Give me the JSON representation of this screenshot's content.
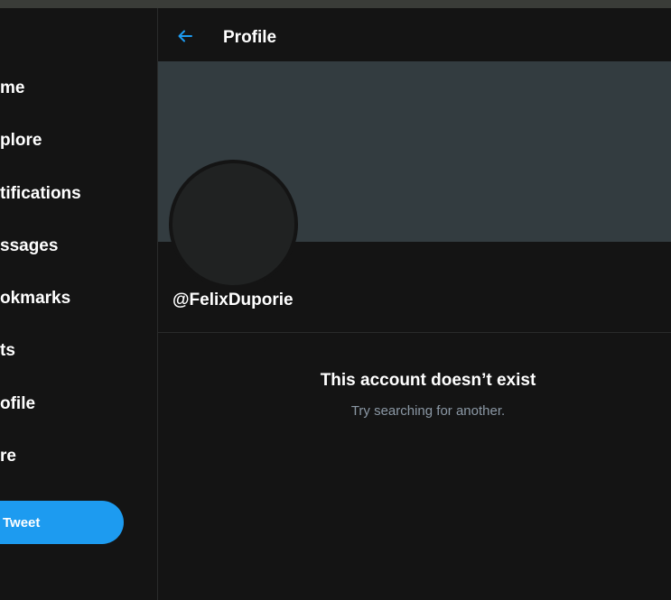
{
  "sidebar": {
    "items": [
      {
        "label": "me"
      },
      {
        "label": "plore"
      },
      {
        "label": "tifications"
      },
      {
        "label": "ssages"
      },
      {
        "label": "okmarks"
      },
      {
        "label": "ts"
      },
      {
        "label": "ofile"
      },
      {
        "label": "re"
      }
    ],
    "tweet_button": "Tweet"
  },
  "header": {
    "back_icon": "arrow-left-icon",
    "title": "Profile"
  },
  "profile": {
    "handle": "@FelixDuporie"
  },
  "empty_state": {
    "title": "This account doesn’t exist",
    "subtitle": "Try searching for another."
  },
  "colors": {
    "accent": "#1d9bf0",
    "background": "#141414",
    "banner": "#333c40",
    "avatar": "#202222",
    "muted_text": "#8b98a5"
  }
}
